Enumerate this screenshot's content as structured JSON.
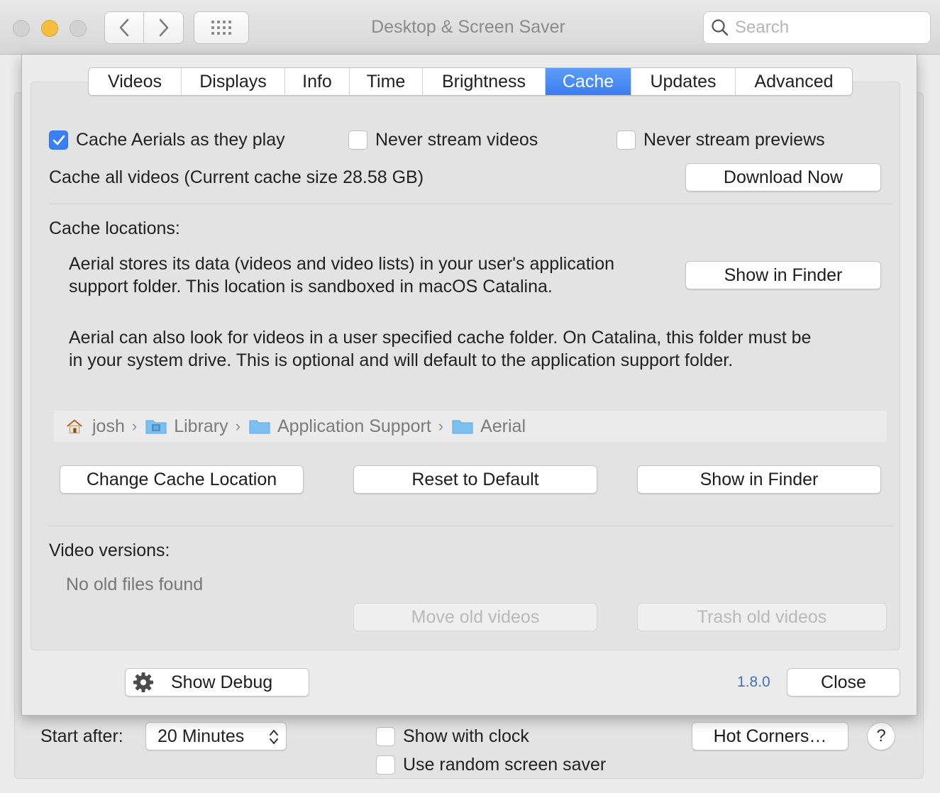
{
  "window": {
    "title": "Desktop & Screen Saver",
    "search_placeholder": "Search"
  },
  "background": {
    "start_after_label": "Start after:",
    "start_after_value": "20 Minutes",
    "show_with_clock": "Show with clock",
    "use_random": "Use random screen saver",
    "hot_corners": "Hot Corners…",
    "help": "?"
  },
  "tabs": [
    {
      "label": "Videos"
    },
    {
      "label": "Displays"
    },
    {
      "label": "Info"
    },
    {
      "label": "Time"
    },
    {
      "label": "Brightness"
    },
    {
      "label": "Cache",
      "active": true
    },
    {
      "label": "Updates"
    },
    {
      "label": "Advanced"
    }
  ],
  "cache": {
    "cache_aerials": "Cache Aerials as they play",
    "cache_aerials_checked": true,
    "never_stream_videos": "Never stream videos",
    "never_stream_previews": "Never stream previews",
    "cache_all_label": "Cache all videos (Current cache size 28.58 GB)",
    "download_now": "Download Now",
    "locations_title": "Cache locations:",
    "locations_desc_1": "Aerial stores its data (videos and video lists) in your user's application",
    "locations_desc_2": "support folder. This location is sandboxed in macOS Catalina.",
    "show_in_finder_1": "Show in Finder",
    "custom_desc_1": "Aerial can also look for videos in a user specified cache folder. On Catalina, this folder must be",
    "custom_desc_2": "in your system drive. This is optional and will default to the application support folder.",
    "path": [
      "josh",
      "Library",
      "Application Support",
      "Aerial"
    ],
    "change_location": "Change Cache Location",
    "reset_default": "Reset to Default",
    "show_in_finder_2": "Show in Finder",
    "versions_title": "Video versions:",
    "no_old_files": "No old files found",
    "move_old": "Move old videos",
    "trash_old": "Trash old videos"
  },
  "footer": {
    "show_debug": "Show Debug",
    "version": "1.8.0",
    "close": "Close"
  },
  "colors": {
    "accent": "#3a80f4",
    "version_link": "#3f6fc1"
  }
}
